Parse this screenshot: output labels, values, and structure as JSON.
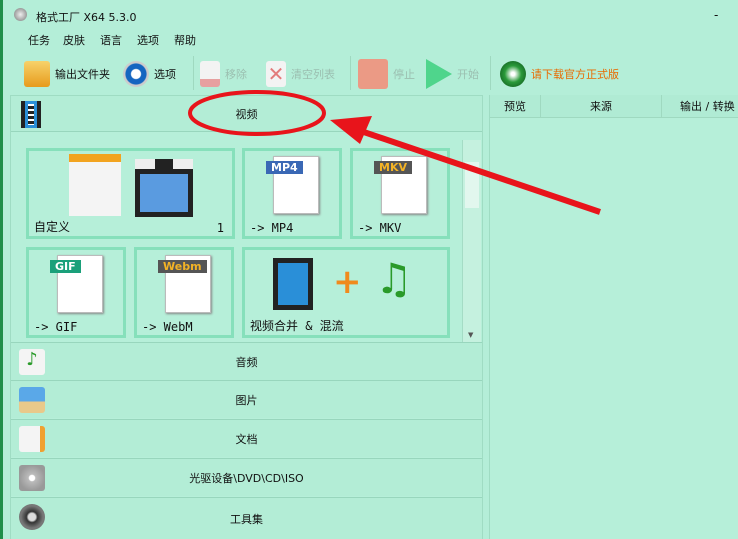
{
  "window": {
    "title": "格式工厂 X64 5.3.0",
    "minimize": "-"
  },
  "menu": [
    "任务",
    "皮肤",
    "语言",
    "选项",
    "帮助"
  ],
  "toolbar": {
    "output_folder": "输出文件夹",
    "options": "选项",
    "remove": "移除",
    "clear_list": "清空列表",
    "stop": "停止",
    "start": "开始",
    "download": "请下载官方正式版"
  },
  "video": {
    "header": "视频",
    "tiles": [
      {
        "label": "自定义",
        "count": "1"
      },
      {
        "label": "-> MP4",
        "badge": "MP4"
      },
      {
        "label": "-> MKV",
        "badge": "MKV"
      },
      {
        "label": "-> GIF",
        "badge": "GIF"
      },
      {
        "label": "-> WebM",
        "badge": "Webm"
      },
      {
        "label": "视频合并 & 混流"
      }
    ]
  },
  "categories": [
    "音频",
    "图片",
    "文档",
    "光驱设备\\DVD\\CD\\ISO",
    "工具集"
  ],
  "table": {
    "columns": [
      "预览",
      "来源",
      "输出 / 转换"
    ]
  },
  "colors": {
    "accent_red": "#e8141b",
    "download_text": "#e86a00"
  }
}
